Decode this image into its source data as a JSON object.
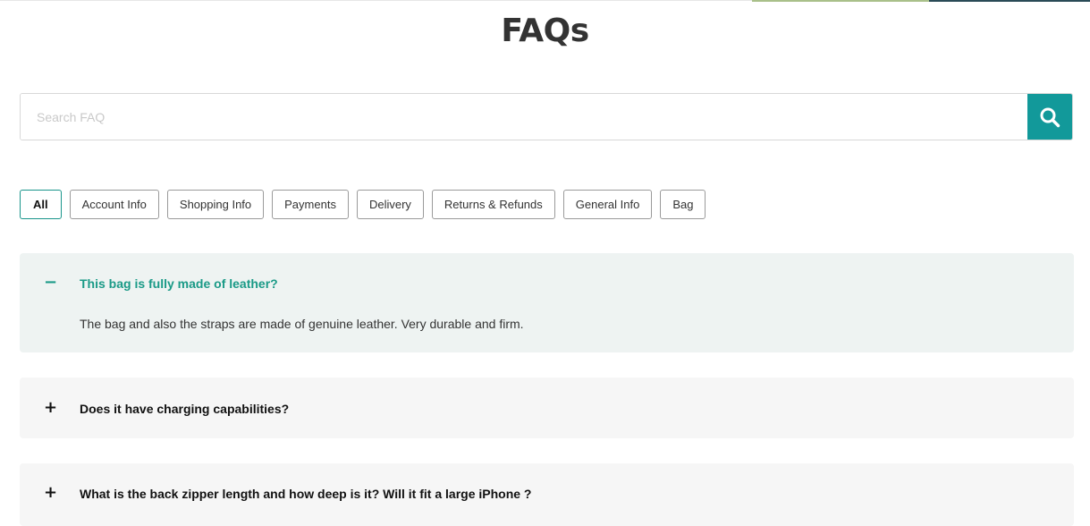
{
  "page": {
    "title": "FAQs"
  },
  "search": {
    "placeholder": "Search FAQ",
    "value": "",
    "button_icon": "search-icon",
    "accent": "#12999a"
  },
  "tabs": [
    {
      "label": "All",
      "active": true
    },
    {
      "label": "Account Info"
    },
    {
      "label": "Shopping Info"
    },
    {
      "label": "Payments"
    },
    {
      "label": "Delivery"
    },
    {
      "label": "Returns & Refunds"
    },
    {
      "label": "General Info"
    },
    {
      "label": "Bag"
    }
  ],
  "faqs": [
    {
      "question": "This bag is fully made of leather?",
      "answer": "The bag and also the straps are made of genuine leather. Very durable and firm.",
      "expanded": true,
      "toggle": "−"
    },
    {
      "question": "Does it have charging capabilities?",
      "expanded": false,
      "toggle": "+"
    },
    {
      "question": "What is the back zipper length and how deep is it? Will it fit a large iPhone ?",
      "expanded": false,
      "toggle": "+"
    }
  ],
  "colors": {
    "accent": "#1a9a87",
    "open_bg": "#eef3f2",
    "closed_bg": "#f6f6f6"
  }
}
